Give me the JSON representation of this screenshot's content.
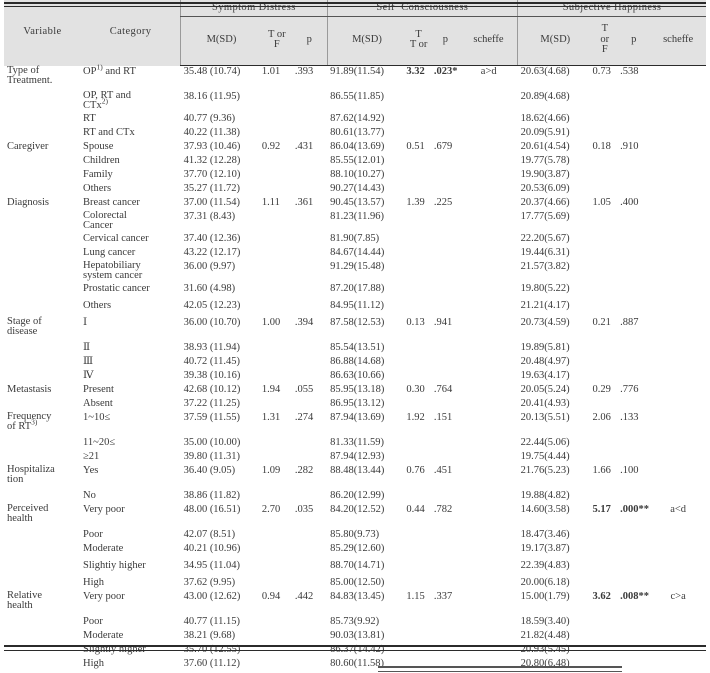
{
  "table": {
    "col_headers": {
      "variable": "Variable",
      "category": "Category"
    },
    "groups": [
      {
        "name": "Symptom Distress",
        "has_scheffe": false
      },
      {
        "name": "Self−Consciousness",
        "has_scheffe": true
      },
      {
        "name": "Subjective  Happiness",
        "has_scheffe": true
      }
    ],
    "sub_headers": {
      "msd": "M(SD)",
      "tf_line1": "T or",
      "tf_line2": "F",
      "tf3_line1": "T",
      "tf3_line2": "or",
      "tf3_line3": "F",
      "p": "p",
      "scheffe": "scheffe"
    },
    "rows": [
      {
        "variable_line1": "Type of",
        "variable_line2": "Treatment.",
        "category": "OP",
        "category_sup": "1)",
        "category_tail": " and RT",
        "sd_msd": "35.48 (10.74)",
        "sd_tf": "1.01",
        "sd_p": ".393",
        "sc_msd": "91.89(11.54)",
        "sc_tf": "3.32",
        "sc_tf_bold": true,
        "sc_p": ".023*",
        "sc_p_bold": true,
        "sc_scheffe": "a>d",
        "sh_msd": "20.63(4.68)",
        "sh_tf": "0.73",
        "sh_p": ".538",
        "sh_scheffe": ""
      },
      {
        "category_line1": "OP, RT and",
        "category_line2": "CTx",
        "category_line2_sup": "2)",
        "sd_msd": "38.16 (11.95)",
        "sd_tf": "",
        "sd_p": "",
        "sc_msd": "86.55(11.85)",
        "sc_tf": "",
        "sc_p": "",
        "sc_scheffe": "",
        "sh_msd": "20.89(4.68)",
        "sh_tf": "",
        "sh_p": "",
        "sh_scheffe": ""
      },
      {
        "category": "RT",
        "sd_msd": "40.77 (9.36)",
        "sd_tf": "",
        "sd_p": "",
        "sc_msd": "87.62(14.92)",
        "sc_tf": "",
        "sc_p": "",
        "sc_scheffe": "",
        "sh_msd": "18.62(4.66)",
        "sh_tf": "",
        "sh_p": "",
        "sh_scheffe": ""
      },
      {
        "category": "RT and CTx",
        "sd_msd": "40.22 (11.38)",
        "sd_tf": "",
        "sd_p": "",
        "sc_msd": "80.61(13.77)",
        "sc_tf": "",
        "sc_p": "",
        "sc_scheffe": "",
        "sh_msd": "20.09(5.91)",
        "sh_tf": "",
        "sh_p": "",
        "sh_scheffe": ""
      },
      {
        "variable": "Caregiver",
        "category": "Spouse",
        "sd_msd": "37.93 (10.46)",
        "sd_tf": "0.92",
        "sd_p": ".431",
        "sc_msd": "86.04(13.69)",
        "sc_tf": "0.51",
        "sc_p": ".679",
        "sc_scheffe": "",
        "sh_msd": "20.61(4.54)",
        "sh_tf": "0.18",
        "sh_p": ".910",
        "sh_scheffe": ""
      },
      {
        "category": "Children",
        "sd_msd": "41.32 (12.28)",
        "sd_tf": "",
        "sd_p": "",
        "sc_msd": "85.55(12.01)",
        "sc_tf": "",
        "sc_p": "",
        "sc_scheffe": "",
        "sh_msd": "19.77(5.78)",
        "sh_tf": "",
        "sh_p": "",
        "sh_scheffe": ""
      },
      {
        "category": "Family",
        "sd_msd": "37.70 (12.10)",
        "sd_tf": "",
        "sd_p": "",
        "sc_msd": "88.10(10.27)",
        "sc_tf": "",
        "sc_p": "",
        "sc_scheffe": "",
        "sh_msd": "19.90(3.87)",
        "sh_tf": "",
        "sh_p": "",
        "sh_scheffe": ""
      },
      {
        "category": "Others",
        "sd_msd": "35.27 (11.72)",
        "sd_tf": "",
        "sd_p": "",
        "sc_msd": "90.27(14.43)",
        "sc_tf": "",
        "sc_p": "",
        "sc_scheffe": "",
        "sh_msd": "20.53(6.09)",
        "sh_tf": "",
        "sh_p": "",
        "sh_scheffe": ""
      },
      {
        "variable": "Diagnosis",
        "category": "Breast cancer",
        "sd_msd": "37.00 (11.54)",
        "sd_tf": "1.11",
        "sd_p": ".361",
        "sc_msd": "90.45(13.57)",
        "sc_tf": "1.39",
        "sc_p": ".225",
        "sc_scheffe": "",
        "sh_msd": "20.37(4.66)",
        "sh_tf": "1.05",
        "sh_p": ".400",
        "sh_scheffe": ""
      },
      {
        "category_line1": "Colorectal",
        "category_line2": "Cancer",
        "sd_msd": "37.31 (8.43)",
        "sd_tf": "",
        "sd_p": "",
        "sc_msd": "81.23(11.96)",
        "sc_tf": "",
        "sc_p": "",
        "sc_scheffe": "",
        "sh_msd": "17.77(5.69)",
        "sh_tf": "",
        "sh_p": "",
        "sh_scheffe": ""
      },
      {
        "category": "Cervical cancer",
        "sd_msd": "37.40 (12.36)",
        "sd_tf": "",
        "sd_p": "",
        "sc_msd": "81.90(7.85)",
        "sc_tf": "",
        "sc_p": "",
        "sc_scheffe": "",
        "sh_msd": "22.20(5.67)",
        "sh_tf": "",
        "sh_p": "",
        "sh_scheffe": ""
      },
      {
        "category": "Lung cancer",
        "sd_msd": "43.22 (12.17)",
        "sd_tf": "",
        "sd_p": "",
        "sc_msd": "84.67(14.44)",
        "sc_tf": "",
        "sc_p": "",
        "sc_scheffe": "",
        "sh_msd": "19.44(6.31)",
        "sh_tf": "",
        "sh_p": "",
        "sh_scheffe": ""
      },
      {
        "category_line1": "Hepatobiliary",
        "category_line2": "system cancer",
        "sd_msd": "36.00 (9.97)",
        "sd_tf": "",
        "sd_p": "",
        "sc_msd": "91.29(15.48)",
        "sc_tf": "",
        "sc_p": "",
        "sc_scheffe": "",
        "sh_msd": "21.57(3.82)",
        "sh_tf": "",
        "sh_p": "",
        "sh_scheffe": ""
      },
      {
        "category": "Prostatic cancer",
        "gap": true,
        "sd_msd": "31.60 (4.98)",
        "sd_tf": "",
        "sd_p": "",
        "sc_msd": "87.20(17.88)",
        "sc_tf": "",
        "sc_p": "",
        "sc_scheffe": "",
        "sh_msd": "19.80(5.22)",
        "sh_tf": "",
        "sh_p": "",
        "sh_scheffe": ""
      },
      {
        "category": "Others",
        "gap": true,
        "sd_msd": "42.05 (12.23)",
        "sd_tf": "",
        "sd_p": "",
        "sc_msd": "84.95(11.12)",
        "sc_tf": "",
        "sc_p": "",
        "sc_scheffe": "",
        "sh_msd": "21.21(4.17)",
        "sh_tf": "",
        "sh_p": "",
        "sh_scheffe": ""
      },
      {
        "variable_line1": "Stage of",
        "variable_line2": "disease",
        "category": "Ⅰ",
        "sd_msd": "36.00 (10.70)",
        "sd_tf": "1.00",
        "sd_p": ".394",
        "sc_msd": "87.58(12.53)",
        "sc_tf": "0.13",
        "sc_p": ".941",
        "sc_scheffe": "",
        "sh_msd": "20.73(4.59)",
        "sh_tf": "0.21",
        "sh_p": ".887",
        "sh_scheffe": ""
      },
      {
        "category": "Ⅱ",
        "sd_msd": "38.93 (11.94)",
        "sd_tf": "",
        "sd_p": "",
        "sc_msd": "85.54(13.51)",
        "sc_tf": "",
        "sc_p": "",
        "sc_scheffe": "",
        "sh_msd": "19.89(5.81)",
        "sh_tf": "",
        "sh_p": "",
        "sh_scheffe": ""
      },
      {
        "category": "Ⅲ",
        "sd_msd": "40.72 (11.45)",
        "sd_tf": "",
        "sd_p": "",
        "sc_msd": "86.88(14.68)",
        "sc_tf": "",
        "sc_p": "",
        "sc_scheffe": "",
        "sh_msd": "20.48(4.97)",
        "sh_tf": "",
        "sh_p": "",
        "sh_scheffe": ""
      },
      {
        "category": "Ⅳ",
        "sd_msd": "39.38 (10.16)",
        "sd_tf": "",
        "sd_p": "",
        "sc_msd": "86.63(10.66)",
        "sc_tf": "",
        "sc_p": "",
        "sc_scheffe": "",
        "sh_msd": "19.63(4.17)",
        "sh_tf": "",
        "sh_p": "",
        "sh_scheffe": ""
      },
      {
        "variable": "Metastasis",
        "category": "Present",
        "sd_msd": "42.68 (10.12)",
        "sd_tf": "1.94",
        "sd_p": ".055",
        "sc_msd": "85.95(13.18)",
        "sc_tf": "0.30",
        "sc_p": ".764",
        "sc_scheffe": "",
        "sh_msd": "20.05(5.24)",
        "sh_tf": "0.29",
        "sh_p": ".776",
        "sh_scheffe": ""
      },
      {
        "category": "Absent",
        "sd_msd": "37.22 (11.25)",
        "sd_tf": "",
        "sd_p": "",
        "sc_msd": "86.95(13.12)",
        "sc_tf": "",
        "sc_p": "",
        "sc_scheffe": "",
        "sh_msd": "20.41(4.93)",
        "sh_tf": "",
        "sh_p": "",
        "sh_scheffe": ""
      },
      {
        "variable_line1": "Frequency",
        "variable_line2": "of RT",
        "variable_line2_sup": "3)",
        "category": "1~10≤",
        "sd_msd": "37.59 (11.55)",
        "sd_tf": "1.31",
        "sd_p": ".274",
        "sc_msd": "87.94(13.69)",
        "sc_tf": "1.92",
        "sc_p": ".151",
        "sc_scheffe": "",
        "sh_msd": "20.13(5.51)",
        "sh_tf": "2.06",
        "sh_p": ".133",
        "sh_scheffe": ""
      },
      {
        "category": "11~20≤",
        "sd_msd": "35.00 (10.00)",
        "sd_tf": "",
        "sd_p": "",
        "sc_msd": "81.33(11.59)",
        "sc_tf": "",
        "sc_p": "",
        "sc_scheffe": "",
        "sh_msd": "22.44(5.06)",
        "sh_tf": "",
        "sh_p": "",
        "sh_scheffe": ""
      },
      {
        "category": "≥21",
        "sd_msd": "39.80 (11.31)",
        "sd_tf": "",
        "sd_p": "",
        "sc_msd": "87.94(12.93)",
        "sc_tf": "",
        "sc_p": "",
        "sc_scheffe": "",
        "sh_msd": "19.75(4.44)",
        "sh_tf": "",
        "sh_p": "",
        "sh_scheffe": ""
      },
      {
        "variable_line1": "Hospitaliza",
        "variable_line2": "tion",
        "category": "Yes",
        "sd_msd": "36.40 (9.05)",
        "sd_tf": "1.09",
        "sd_p": ".282",
        "sc_msd": "88.48(13.44)",
        "sc_tf": "0.76",
        "sc_p": ".451",
        "sc_scheffe": "",
        "sh_msd": "21.76(5.23)",
        "sh_tf": "1.66",
        "sh_p": ".100",
        "sh_scheffe": ""
      },
      {
        "category": "No",
        "sd_msd": "38.86 (11.82)",
        "sd_tf": "",
        "sd_p": "",
        "sc_msd": "86.20(12.99)",
        "sc_tf": "",
        "sc_p": "",
        "sc_scheffe": "",
        "sh_msd": "19.88(4.82)",
        "sh_tf": "",
        "sh_p": "",
        "sh_scheffe": ""
      },
      {
        "variable_line1": "Perceived",
        "variable_line2": "health",
        "category": "Very poor",
        "sd_msd": "48.00 (16.51)",
        "sd_tf": "2.70",
        "sd_p": ".035",
        "sc_msd": "84.20(12.52)",
        "sc_tf": "0.44",
        "sc_p": ".782",
        "sc_scheffe": "",
        "sh_msd": "14.60(3.58)",
        "sh_tf": "5.17",
        "sh_tf_bold": true,
        "sh_p": ".000**",
        "sh_p_bold": true,
        "sh_scheffe": "a<d"
      },
      {
        "category": "Poor",
        "sd_msd": "42.07 (8.51)",
        "sd_tf": "",
        "sd_p": "",
        "sc_msd": "85.80(9.73)",
        "sc_tf": "",
        "sc_p": "",
        "sc_scheffe": "",
        "sh_msd": "18.47(3.46)",
        "sh_tf": "",
        "sh_p": "",
        "sh_scheffe": ""
      },
      {
        "category": "Moderate",
        "gap": true,
        "sd_msd": "40.21 (10.96)",
        "sd_tf": "",
        "sd_p": "",
        "sc_msd": "85.29(12.60)",
        "sc_tf": "",
        "sc_p": "",
        "sc_scheffe": "",
        "sh_msd": "19.17(3.87)",
        "sh_tf": "",
        "sh_p": "",
        "sh_scheffe": ""
      },
      {
        "category": "Slightiy higher",
        "gap": true,
        "sd_msd": "34.95 (11.04)",
        "sd_tf": "",
        "sd_p": "",
        "sc_msd": "88.70(14.71)",
        "sc_tf": "",
        "sc_p": "",
        "sc_scheffe": "",
        "sh_msd": "22.39(4.83)",
        "sh_tf": "",
        "sh_p": "",
        "sh_scheffe": ""
      },
      {
        "category": "High",
        "sd_msd": "37.62 (9.95)",
        "sd_tf": "",
        "sd_p": "",
        "sc_msd": "85.00(12.50)",
        "sc_tf": "",
        "sc_p": "",
        "sc_scheffe": "",
        "sh_msd": "20.00(6.18)",
        "sh_tf": "",
        "sh_p": "",
        "sh_scheffe": ""
      },
      {
        "variable_line1": "Relative",
        "variable_line2": "health",
        "category": "Very poor",
        "sd_msd": "43.00 (12.62)",
        "sd_tf": "0.94",
        "sd_p": ".442",
        "sc_msd": "84.83(13.45)",
        "sc_tf": "1.15",
        "sc_p": ".337",
        "sc_scheffe": "",
        "sh_msd": "15.00(1.79)",
        "sh_tf": "3.62",
        "sh_tf_bold": true,
        "sh_p": ".008**",
        "sh_p_bold": true,
        "sh_scheffe": "c>a"
      },
      {
        "category": "Poor",
        "sd_msd": "40.77 (11.15)",
        "sd_tf": "",
        "sd_p": "",
        "sc_msd": "85.73(9.92)",
        "sc_tf": "",
        "sc_p": "",
        "sc_scheffe": "",
        "sh_msd": "18.59(3.40)",
        "sh_tf": "",
        "sh_p": "",
        "sh_scheffe": ""
      },
      {
        "category": "Moderate",
        "sd_msd": "38.21 (9.68)",
        "sd_tf": "",
        "sd_p": "",
        "sc_msd": "90.03(13.81)",
        "sc_tf": "",
        "sc_p": "",
        "sc_scheffe": "",
        "sh_msd": "21.82(4.48)",
        "sh_tf": "",
        "sh_p": "",
        "sh_scheffe": ""
      },
      {
        "category": "Slightly higher",
        "sd_msd": "35.70 (12.55)",
        "sd_tf": "",
        "sd_p": "",
        "sc_msd": "86.37(14.42)",
        "sc_tf": "",
        "sc_p": "",
        "sc_scheffe": "",
        "sh_msd": "20.93(5.45)",
        "sh_tf": "",
        "sh_p": "",
        "sh_scheffe": ""
      },
      {
        "category": "High",
        "sd_msd": "37.60 (11.12)",
        "sd_tf": "",
        "sd_p": "",
        "sc_msd": "80.60(11.58)",
        "sc_tf": "",
        "sc_p": "",
        "sc_scheffe": "",
        "sh_msd": "20.80(6.48)",
        "sh_tf": "",
        "sh_p": "",
        "sh_scheffe": ""
      }
    ]
  }
}
